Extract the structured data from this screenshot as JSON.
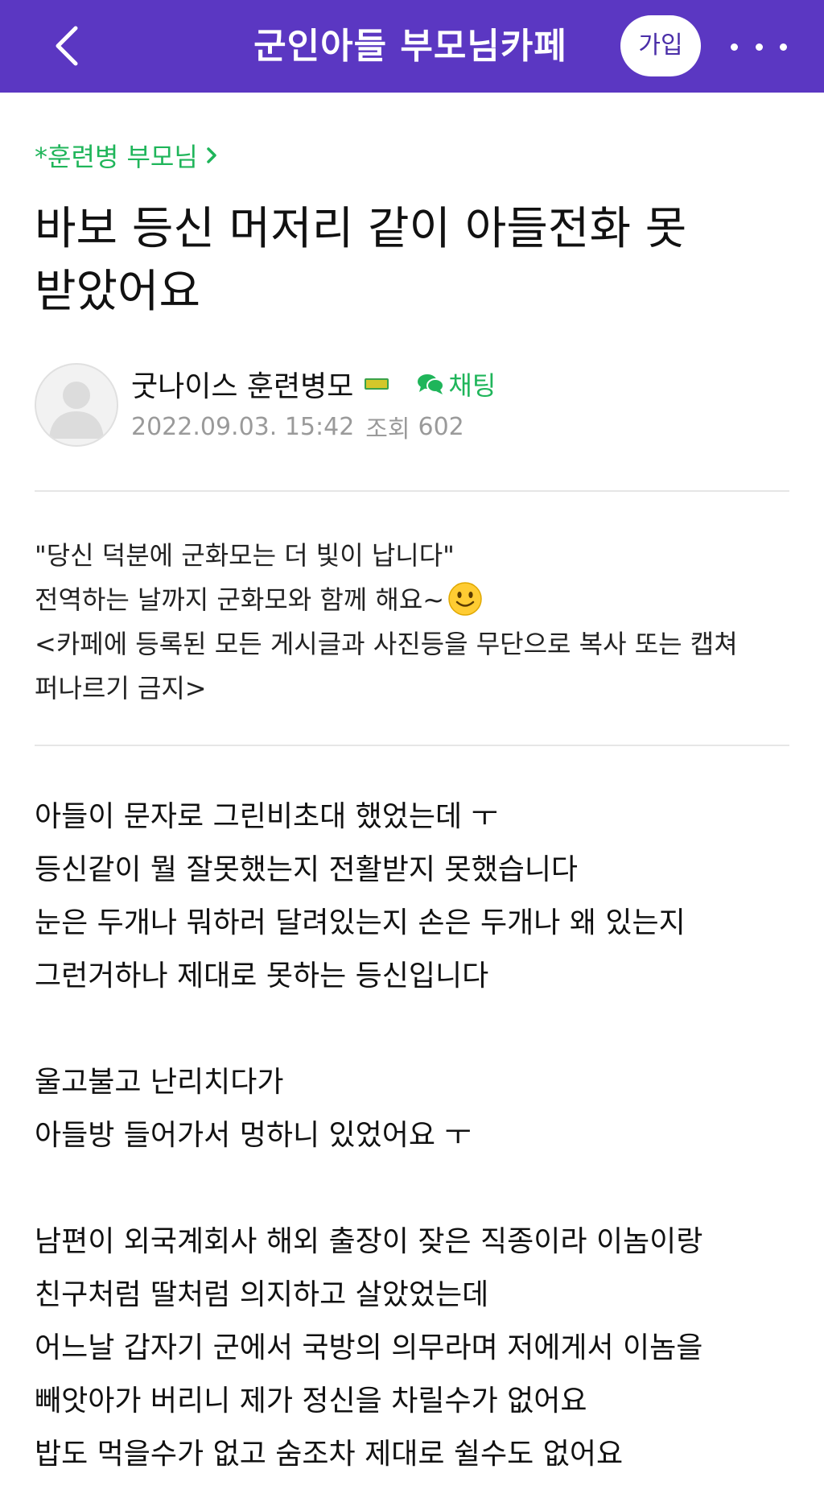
{
  "header": {
    "back_icon": "chevron-left-icon",
    "cafe_title": "군인아들 부모님카페",
    "join_label": "가입",
    "more_icon": "more-horizontal-icon",
    "bg_color": "#5b37c2"
  },
  "post": {
    "board_name": "*훈련병 부모님",
    "board_color": "#1fb55a",
    "title_line1": "바보 등신 머저리 같이 아들전화 못",
    "title_line2": "받았어요",
    "author": {
      "name": "굿나이스 훈련병모",
      "chat_label": "채팅",
      "date": "2022.09.03. 15:42",
      "views_label": "조회",
      "views_count": "602"
    }
  },
  "notice": {
    "line1": "\"당신 덕분에 군화모는 더 빛이 납니다\"",
    "line2": "전역하는 날까지 군화모와 함께 해요~",
    "line3": "<카페에 등록된 모든 게시글과 사진등을 무단으로 복사 또는 캡쳐",
    "line4": "퍼나르기 금지>"
  },
  "body": {
    "lines": [
      "아들이 문자로 그린비초대 했었는데 ㅜ",
      "등신같이 뭘 잘못했는지 전활받지 못했습니다",
      "눈은 두개나 뭐하러 달려있는지 손은 두개나 왜 있는지",
      "그런거하나 제대로 못하는 등신입니다",
      "",
      "울고불고 난리치다가",
      "아들방 들어가서 멍하니 있었어요 ㅜ",
      "",
      "남편이 외국계회사 해외 출장이 잦은 직종이라 이놈이랑",
      "친구처럼 딸처럼 의지하고 살았었는데",
      "어느날 갑자기 군에서 국방의 의무라며 저에게서 이놈을",
      "빼앗아가 버리니 제가 정신을 차릴수가 없어요",
      "밥도 먹을수가 없고 숨조차 제대로 쉴수도 없어요"
    ]
  }
}
